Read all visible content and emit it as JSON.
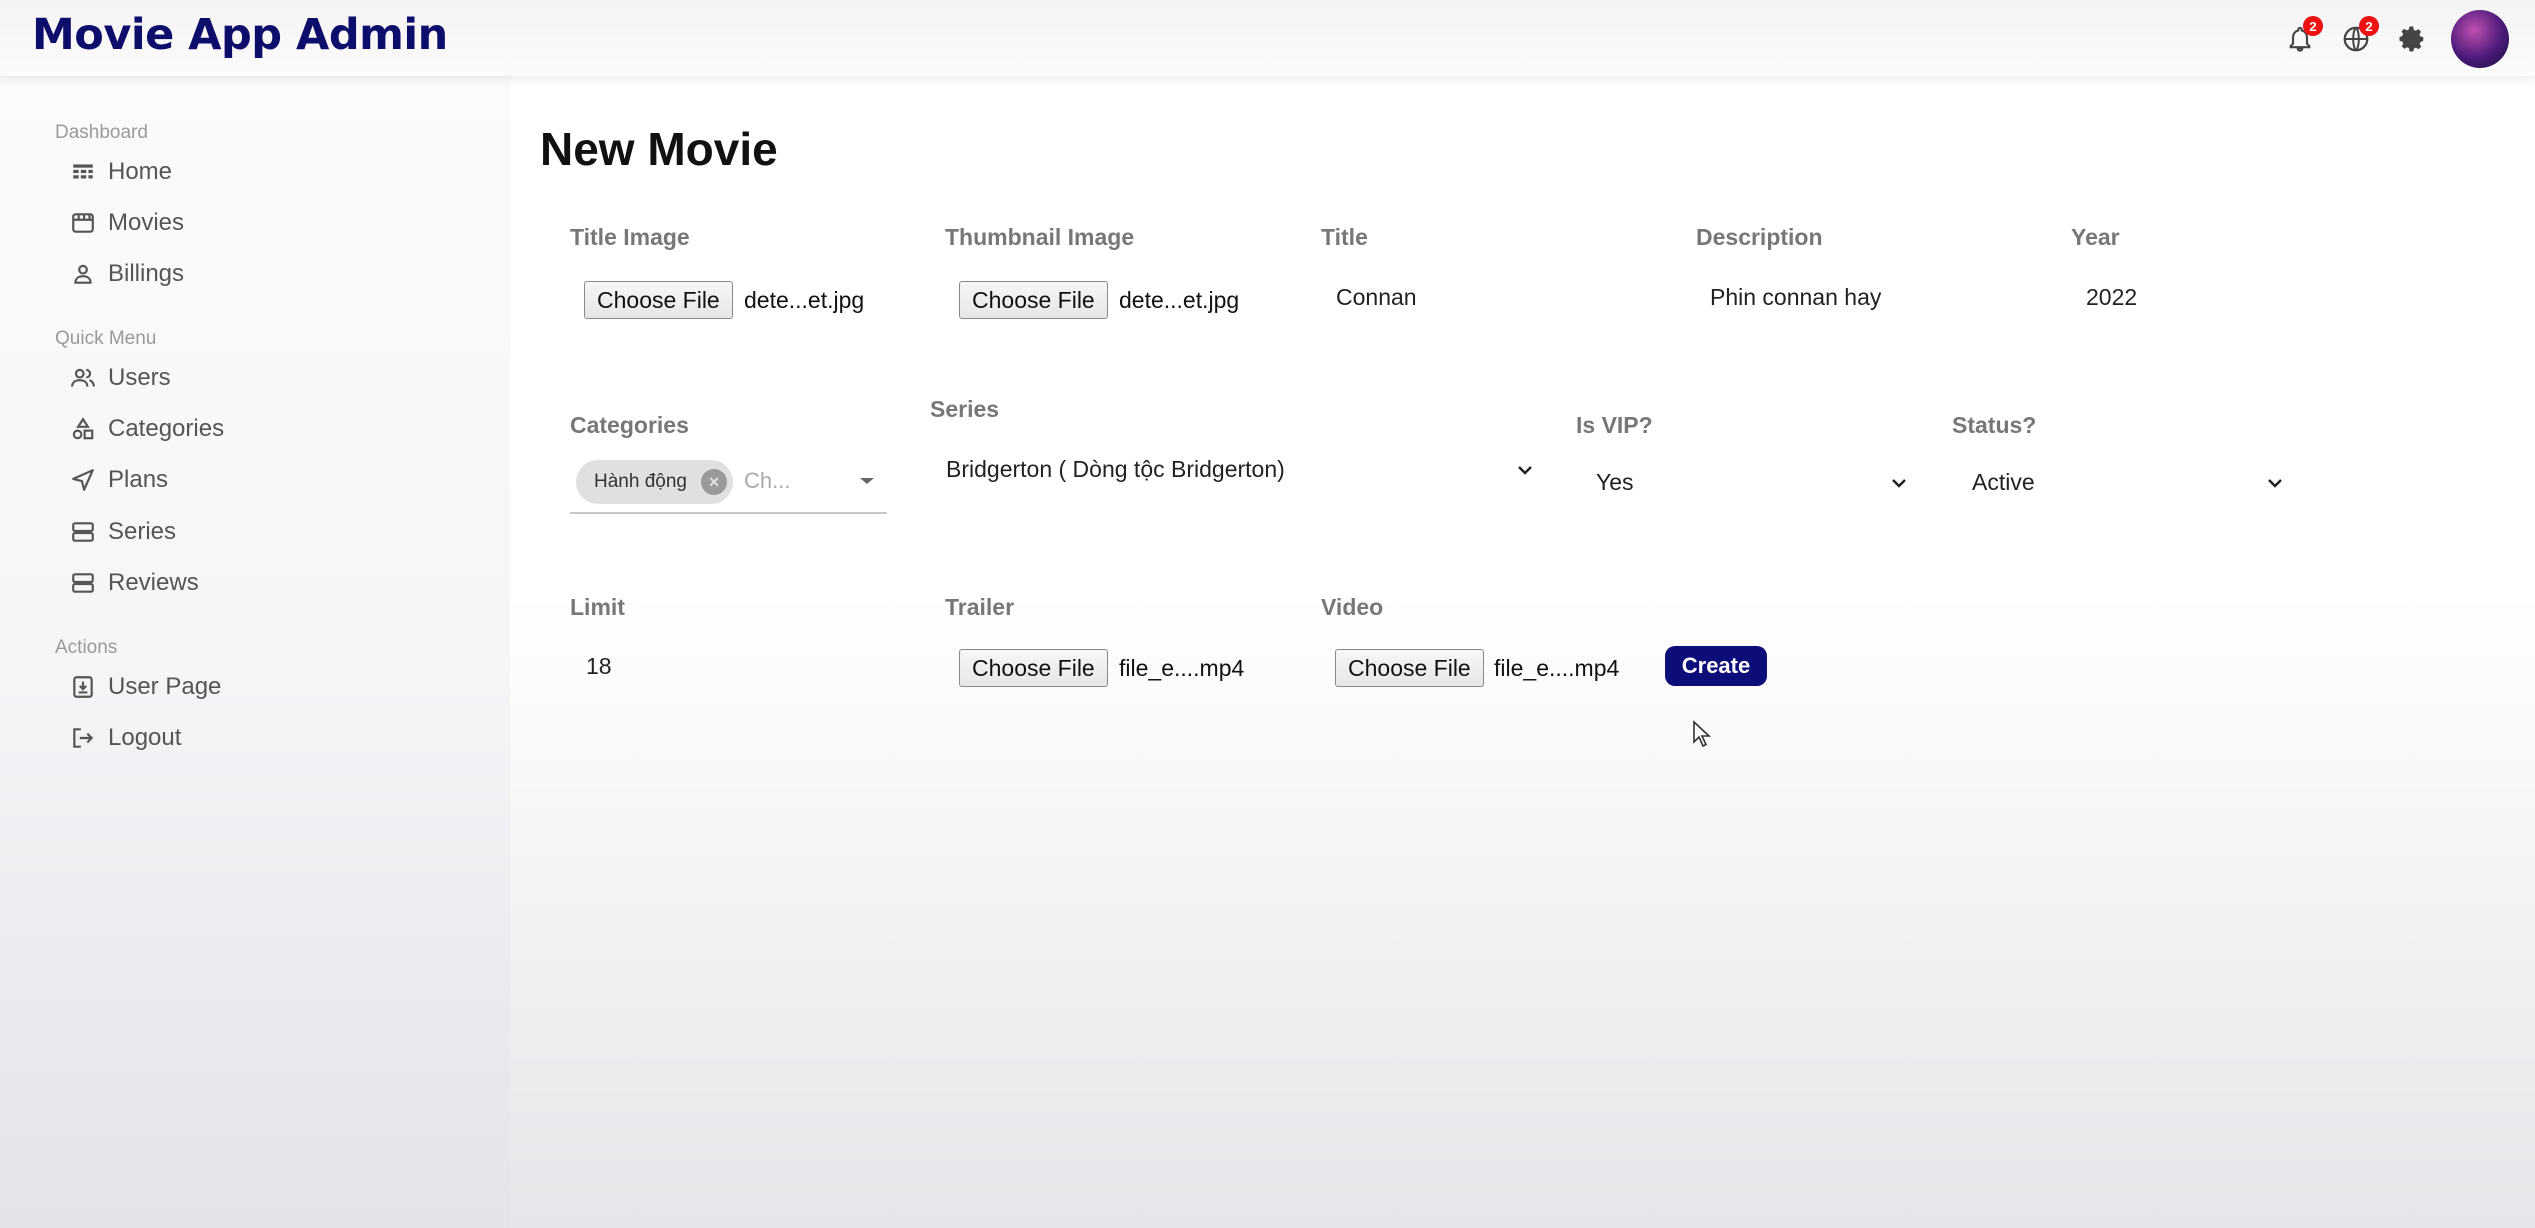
{
  "app": {
    "title": "Movie App Admin"
  },
  "topbar": {
    "notifications": {
      "icon": "bell-icon",
      "count": "2"
    },
    "language": {
      "icon": "globe-icon",
      "count": "2"
    },
    "settings": {
      "icon": "gear-icon"
    },
    "avatar": {
      "icon": "user-avatar"
    }
  },
  "sidebar": {
    "sections": [
      {
        "title": "Dashboard",
        "items": [
          {
            "label": "Home",
            "icon": "home-icon"
          },
          {
            "label": "Movies",
            "icon": "movies-icon"
          },
          {
            "label": "Billings",
            "icon": "person-icon"
          }
        ]
      },
      {
        "title": "Quick Menu",
        "items": [
          {
            "label": "Users",
            "icon": "users-icon"
          },
          {
            "label": "Categories",
            "icon": "shapes-icon"
          },
          {
            "label": "Plans",
            "icon": "send-icon"
          },
          {
            "label": "Series",
            "icon": "storage-icon"
          },
          {
            "label": "Reviews",
            "icon": "storage-icon"
          }
        ]
      },
      {
        "title": "Actions",
        "items": [
          {
            "label": "User Page",
            "icon": "user-page-icon"
          },
          {
            "label": "Logout",
            "icon": "logout-icon"
          }
        ]
      }
    ]
  },
  "form": {
    "title": "New Movie",
    "title_image": {
      "label": "Title Image",
      "button": "Choose File",
      "file": "dete...et.jpg"
    },
    "thumbnail_image": {
      "label": "Thumbnail Image",
      "button": "Choose File",
      "file": "dete...et.jpg"
    },
    "title_field": {
      "label": "Title",
      "value": "Connan"
    },
    "description": {
      "label": "Description",
      "value": "Phin connan hay"
    },
    "year": {
      "label": "Year",
      "value": "2022"
    },
    "categories": {
      "label": "Categories",
      "chip": "Hành động",
      "placeholder": "Ch..."
    },
    "series": {
      "label": "Series",
      "value": "Bridgerton ( Dòng tộc Bridgerton)"
    },
    "is_vip": {
      "label": "Is VIP?",
      "value": "Yes"
    },
    "status": {
      "label": "Status?",
      "value": "Active"
    },
    "limit": {
      "label": "Limit",
      "value": "18"
    },
    "trailer": {
      "label": "Trailer",
      "button": "Choose File",
      "file": "file_e....mp4"
    },
    "video": {
      "label": "Video",
      "button": "Choose File",
      "file": "file_e....mp4"
    },
    "create_button": "Create"
  }
}
